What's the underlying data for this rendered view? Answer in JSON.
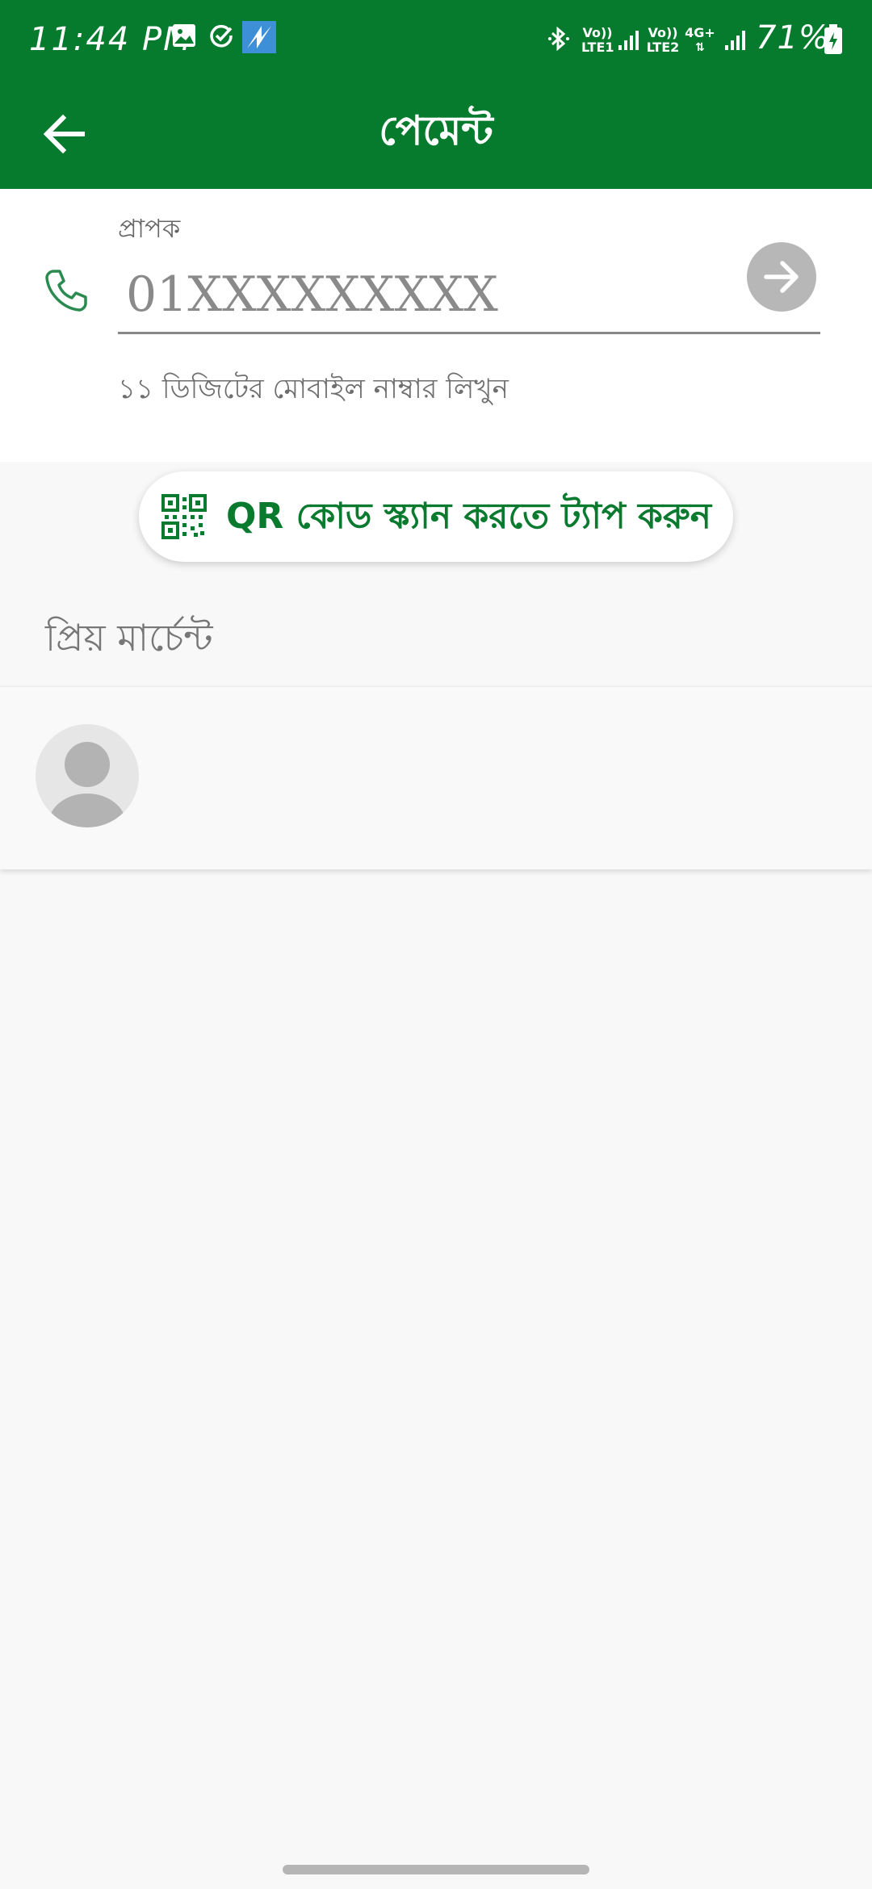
{
  "status_bar": {
    "time": "11:44 PM",
    "sim1_label_top": "Vo))",
    "sim1_label_bottom": "LTE1",
    "sim2_label_top": "Vo))",
    "sim2_label_bottom": "LTE2",
    "network": "4G+",
    "battery": "71%"
  },
  "app_bar": {
    "title": "পেমেন্ট"
  },
  "recipient": {
    "label": "প্রাপক",
    "placeholder": "01XXXXXXXXX",
    "helper": "১১ ডিজিটের মোবাইল নাম্বার লিখুন"
  },
  "qr_button": {
    "label": "QR কোড স্ক্যান করতে ট্যাপ করুন"
  },
  "favorite_merchants": {
    "heading": "প্রিয় মার্চেন্ট"
  },
  "colors": {
    "brand_green": "#067a2d",
    "qr_text_green": "#0a7a2f",
    "go_button_gray": "#b7b7b7"
  }
}
